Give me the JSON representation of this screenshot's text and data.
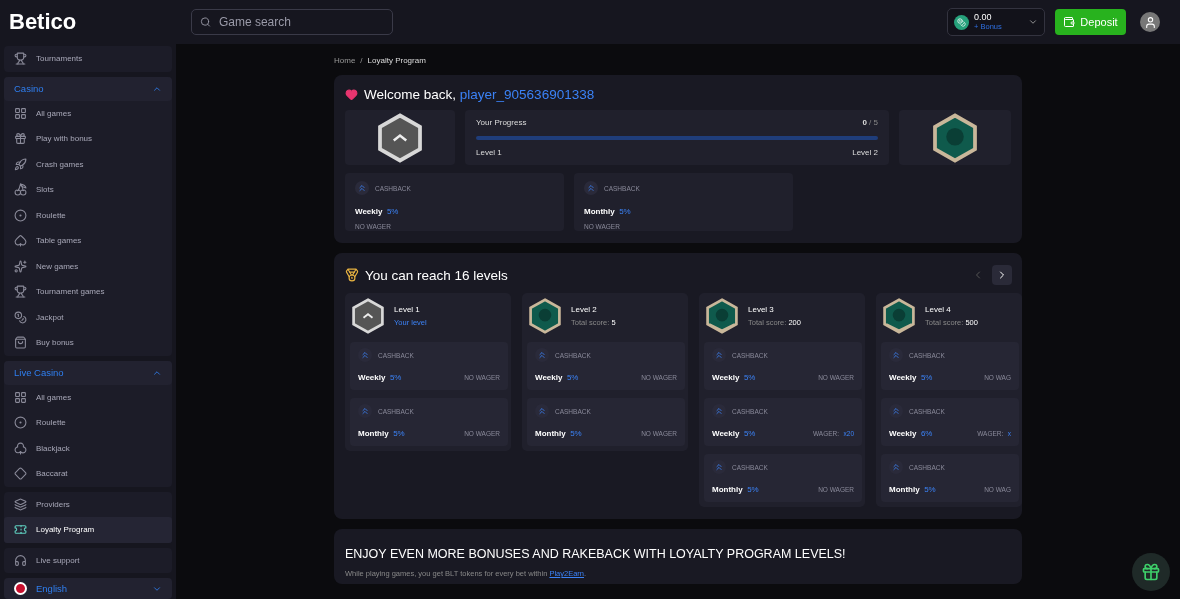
{
  "header": {
    "logo": "Betico",
    "search": {
      "placeholder": "Game search"
    },
    "balance": {
      "amount": "0.00",
      "bonus": "+ Bonus"
    },
    "deposit": "Deposit"
  },
  "sidebar": {
    "groups": [
      {
        "items": [
          {
            "label": "Tournaments",
            "selected": false
          }
        ]
      },
      {
        "title": "Casino",
        "expanded": true,
        "items": [
          {
            "label": "All games",
            "selected": false
          },
          {
            "label": "Play with bonus",
            "selected": false
          },
          {
            "label": "Crash games",
            "selected": false
          },
          {
            "label": "Slots",
            "selected": false
          },
          {
            "label": "Roulette",
            "selected": false
          },
          {
            "label": "Table games",
            "selected": false
          },
          {
            "label": "New games",
            "selected": false
          },
          {
            "label": "Tournament games",
            "selected": false
          },
          {
            "label": "Jackpot",
            "selected": false
          },
          {
            "label": "Buy bonus",
            "selected": false
          }
        ]
      },
      {
        "title": "Live Casino",
        "expanded": true,
        "items": [
          {
            "label": "All games",
            "selected": false
          },
          {
            "label": "Roulette",
            "selected": false
          },
          {
            "label": "Blackjack",
            "selected": false
          },
          {
            "label": "Baccarat",
            "selected": false
          }
        ]
      },
      {
        "items": [
          {
            "label": "Providers",
            "selected": false
          },
          {
            "label": "Loyalty Program",
            "selected": true
          }
        ]
      },
      {
        "items": [
          {
            "label": "Live support",
            "selected": false
          }
        ]
      }
    ],
    "language": {
      "label": "English",
      "expanded": false
    }
  },
  "breadcrumb": {
    "items": [
      "Home",
      "Loyalty Program"
    ],
    "separator": "/"
  },
  "welcome": {
    "greeting": "Welcome back,",
    "username": "player_905636901338",
    "progress": {
      "title": "Your Progress",
      "current": "0",
      "total": "/ 5",
      "level": 0,
      "from": "Level 1",
      "to": "Level 2"
    },
    "cashback": [
      {
        "label": "CASHBACK",
        "period": "Weekly",
        "percent": "5%",
        "wager": "NO WAGER"
      },
      {
        "label": "CASHBACK",
        "period": "Monthly",
        "percent": "5%",
        "wager": "NO WAGER"
      }
    ]
  },
  "levels": {
    "title": "You can reach 16 levels",
    "prev_disabled": true,
    "next_disabled": false,
    "cards": [
      {
        "name": "Level 1",
        "kind": "silver",
        "current": true,
        "status": "Your level",
        "rewards": [
          {
            "label": "CASHBACK",
            "period": "Weekly",
            "percent": "5%",
            "wager": "NO WAGER"
          },
          {
            "label": "CASHBACK",
            "period": "Monthly",
            "percent": "5%",
            "wager": "NO WAGER"
          }
        ]
      },
      {
        "name": "Level 2",
        "kind": "teal",
        "current": false,
        "score_label": "Total score:",
        "score": "5",
        "rewards": [
          {
            "label": "CASHBACK",
            "period": "Weekly",
            "percent": "5%",
            "wager": "NO WAGER"
          },
          {
            "label": "CASHBACK",
            "period": "Monthly",
            "percent": "5%",
            "wager": "NO WAGER"
          }
        ]
      },
      {
        "name": "Level 3",
        "kind": "teal-striped",
        "current": false,
        "score_label": "Total score:",
        "score": "200",
        "rewards": [
          {
            "label": "CASHBACK",
            "period": "Weekly",
            "percent": "5%",
            "wager": "NO WAGER"
          },
          {
            "label": "CASHBACK",
            "period": "Weekly",
            "percent": "5%",
            "wager": "WAGER:",
            "wager_value": "x20"
          },
          {
            "label": "CASHBACK",
            "period": "Monthly",
            "percent": "5%",
            "wager": "NO WAGER"
          }
        ]
      },
      {
        "name": "Level 4",
        "kind": "teal-striped",
        "current": false,
        "score_label": "Total score:",
        "score": "500",
        "rewards": [
          {
            "label": "CASHBACK",
            "period": "Weekly",
            "percent": "5%",
            "wager": "NO WAG"
          },
          {
            "label": "CASHBACK",
            "period": "Weekly",
            "percent": "6%",
            "wager": "WAGER:",
            "wager_value": "x"
          },
          {
            "label": "CASHBACK",
            "period": "Monthly",
            "percent": "5%",
            "wager": "NO WAG"
          }
        ]
      }
    ]
  },
  "promo": {
    "title": "ENJOY EVEN MORE BONUSES AND RAKEBACK WITH LOYALTY PROGRAM LEVELS!",
    "text": "While playing games, you get BLT tokens for every bet within ",
    "link": "Play2Earn",
    "end": "."
  }
}
